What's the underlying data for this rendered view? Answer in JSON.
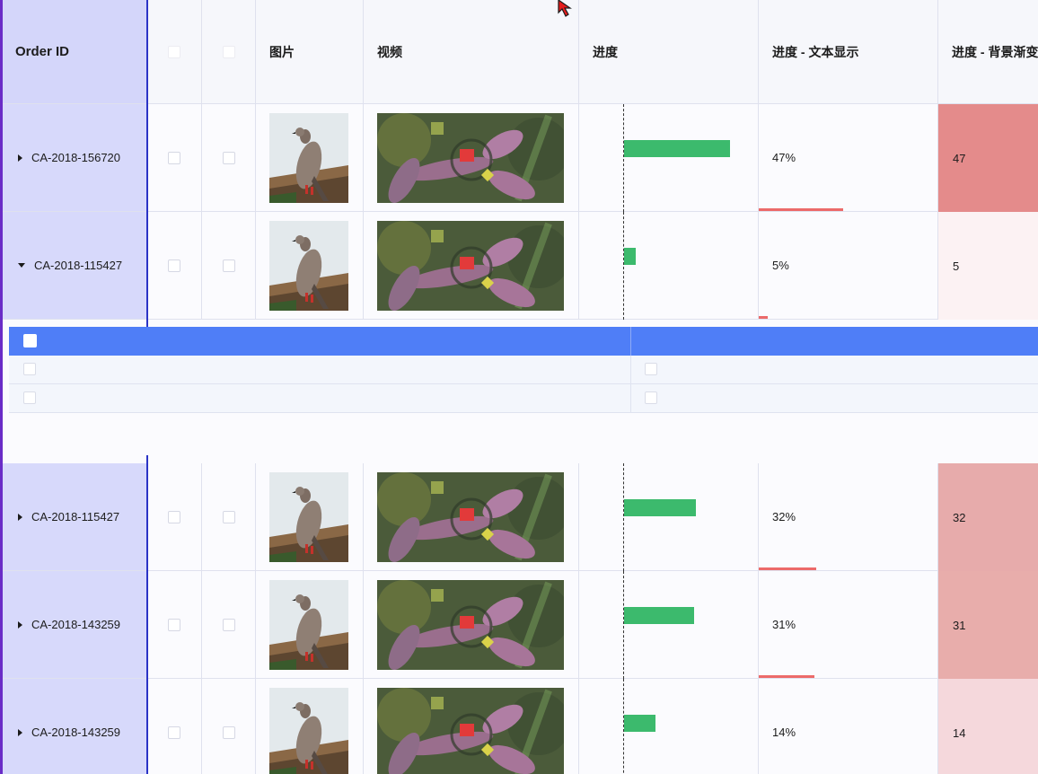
{
  "columns": {
    "order_id": "Order ID",
    "image": "图片",
    "video": "视频",
    "progress": "进度",
    "progress_text": "进度 - 文本显示",
    "progress_gradient": "进度 - 背景渐变"
  },
  "rows": [
    {
      "order_id": "CA-2018-156720",
      "expanded": false,
      "progress": 47,
      "progress_label": "47%",
      "gradient_value": "47"
    },
    {
      "order_id": "CA-2018-115427",
      "expanded": true,
      "progress": 5,
      "progress_label": "5%",
      "gradient_value": "5"
    },
    {
      "order_id": "CA-2018-115427",
      "expanded": false,
      "progress": 32,
      "progress_label": "32%",
      "gradient_value": "32"
    },
    {
      "order_id": "CA-2018-143259",
      "expanded": false,
      "progress": 31,
      "progress_label": "31%",
      "gradient_value": "31"
    },
    {
      "order_id": "CA-2018-143259",
      "expanded": false,
      "progress": 14,
      "progress_label": "14%",
      "gradient_value": "14"
    }
  ],
  "icons": {
    "expand_collapsed": "caret-right-icon",
    "expand_open": "caret-down-icon",
    "cursor": "pointer-cursor-icon"
  },
  "colors": {
    "frozen_column": "#d7d9fb",
    "progress_bar": "#3cba6d",
    "text_underline": "#ec6a6a",
    "subtable_header": "#4f7ef7"
  }
}
